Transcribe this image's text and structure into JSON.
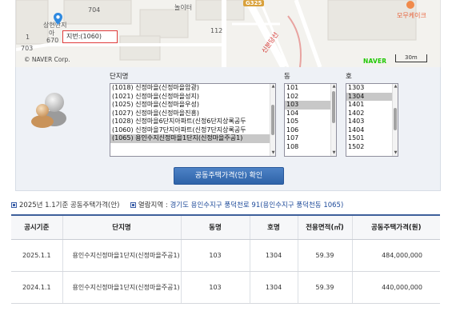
{
  "map": {
    "labels": {
      "n704": "704",
      "playground": "놀이터",
      "n112": "112",
      "n703": "703",
      "apt_name_1": "상현단지",
      "apt_name_2": "아",
      "apt_name_3": "670",
      "n1": "1",
      "road": "신분당선",
      "route": "G325",
      "cafe": "모무케이크"
    },
    "tooltip": "지번:(1060)",
    "copyright": "© NAVER Corp.",
    "brand": "NAVER",
    "scale": "30m"
  },
  "panel": {
    "complex_label": "단지명",
    "dong_label": "동",
    "ho_label": "호",
    "complexes": [
      "(1018) 신정마을(신정마을암광)",
      "(1021) 신정마을(신정마을성지)",
      "(1025) 신정마을(신정마을우성)",
      "(1027) 신정마을(신정마을진흥)",
      "(1028) 신정마을6단지아파트(신정6단지상록공두",
      "(1060) 신정마을7단지아파트(신정7단지상록공두",
      "(1065) 용인수지신정마을1단지(신정마을주공1)"
    ],
    "selected_complex": "(1065) 용인수지신정마을1단지(신정마을주공1)",
    "dongs": [
      "101",
      "102",
      "103",
      "104",
      "105",
      "106",
      "107",
      "108"
    ],
    "selected_dong": "103",
    "hos": [
      "1303",
      "1304",
      "1401",
      "1402",
      "1403",
      "1404",
      "1501",
      "1502"
    ],
    "selected_ho": "1304",
    "confirm_button": "공동주택가격(안) 확인",
    "colors": {
      "button": "#3a6fb5",
      "selected_row": "#c8c8c8",
      "panel_bg": "#eef1f6"
    }
  },
  "info": {
    "basis": "2025년 1.1기준 공동주택가격(안)",
    "region_label": "열람지역 :",
    "address": "경기도 용인수지구 풍덕천로 91(용인수지구 풍덕천동 1065)"
  },
  "table": {
    "headers": [
      "공시기준",
      "단지명",
      "동명",
      "호명",
      "전용면적(㎡)",
      "공동주택가격(원)"
    ],
    "rows": [
      {
        "date": "2025.1.1",
        "name": "용인수지신정마을1단지(신정마을주공1)",
        "dong": "103",
        "ho": "1304",
        "area": "59.39",
        "price": "484,000,000"
      },
      {
        "date": "2024.1.1",
        "name": "용인수지신정마을1단지(신정마을주공1)",
        "dong": "103",
        "ho": "1304",
        "area": "59.39",
        "price": "440,000,000"
      }
    ]
  },
  "icons": {
    "pin": "map-pin-icon",
    "avatar": "user-silhouette-icon",
    "info_square": "square-bullet-icon"
  }
}
